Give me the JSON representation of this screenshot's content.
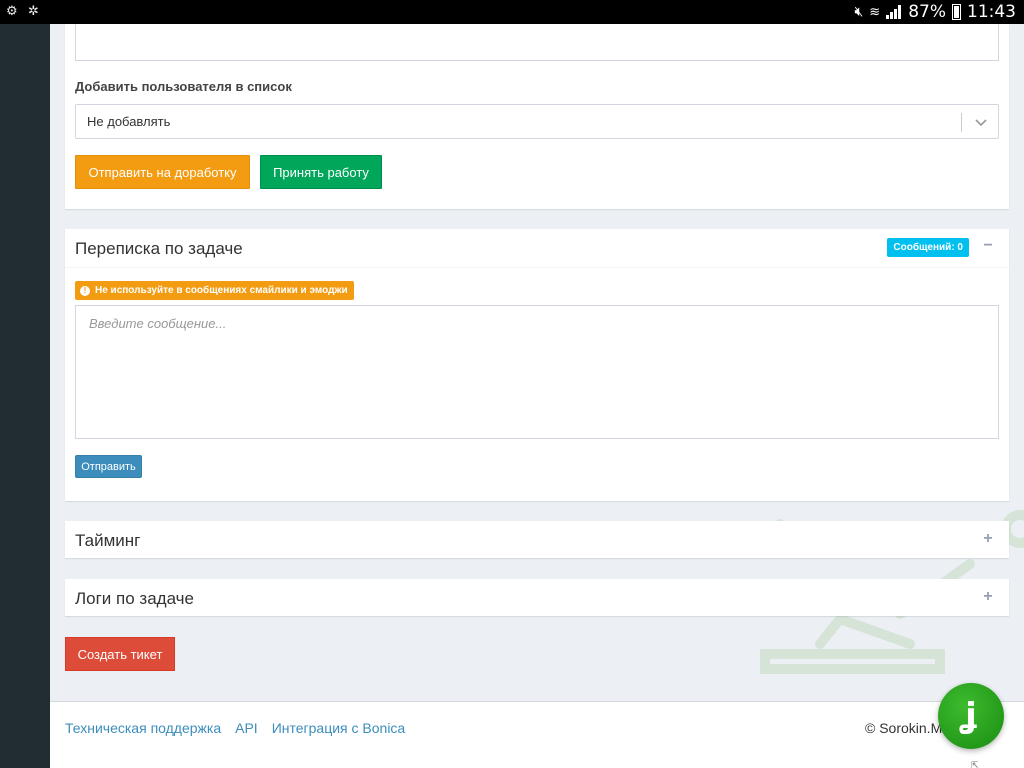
{
  "status_bar": {
    "battery": "87%",
    "time": "11:43",
    "icons": [
      "usb-icon",
      "bug-icon",
      "mute-icon",
      "wifi-icon",
      "signal-icon",
      "battery-icon"
    ]
  },
  "task_form": {
    "add_user_label": "Добавить пользователя в список",
    "add_user_select_value": "Не добавлять",
    "return_button": "Отправить на доработку",
    "accept_button": "Принять работу"
  },
  "correspondence": {
    "title": "Переписка по задаче",
    "messages_badge": "Сообщений: 0",
    "warning": "Не используйте в сообщениях смайлики и эмоджи",
    "message_placeholder": "Введите сообщение...",
    "send_button": "Отправить"
  },
  "timing": {
    "title": "Тайминг"
  },
  "logs": {
    "title": "Логи по задаче"
  },
  "create_ticket_button": "Создать тикет",
  "footer": {
    "links": [
      "Техническая поддержка",
      "API",
      "Интеграция с Bonica"
    ],
    "copyright": "© Sorokin.Me"
  },
  "chat_widget": {
    "glyph": "ʝ"
  },
  "colors": {
    "warning": "#f39c12",
    "success": "#00a65a",
    "info": "#00c0ef",
    "primary": "#3c8dbc",
    "danger": "#dd4b39",
    "sidebar": "#222d32",
    "chat": "#2aa31f"
  }
}
